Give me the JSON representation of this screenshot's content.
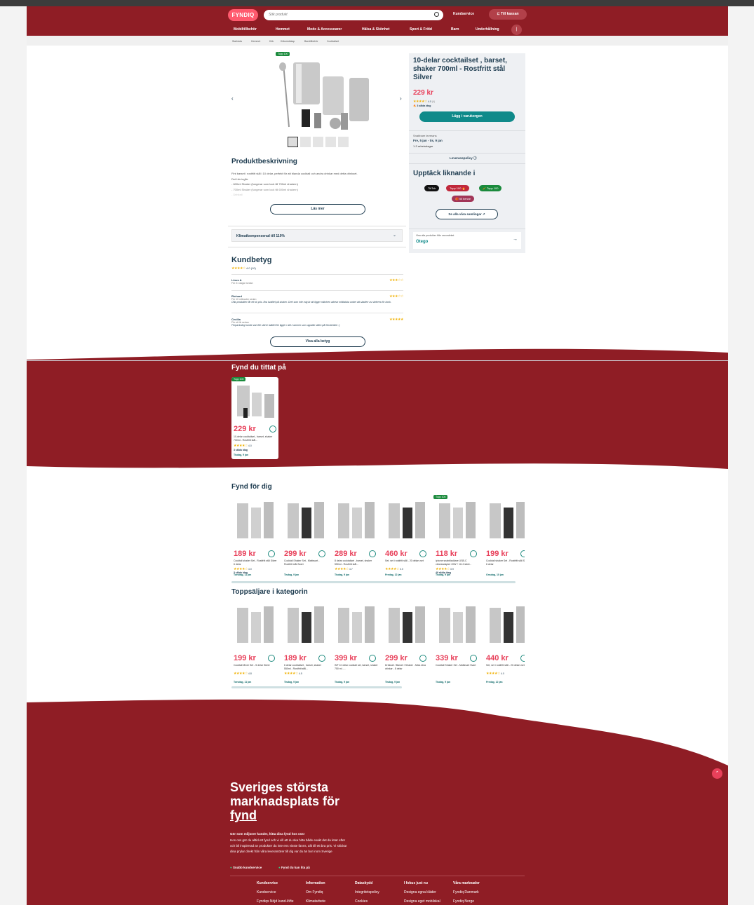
{
  "header": {
    "logo": "FYNDIQ",
    "search_placeholder": "Sök produkt",
    "customer_service": "Kundservice",
    "checkout": "Till kassan",
    "nav": [
      "Mobiltillbehör",
      "Hemmet",
      "Mode & Accessoarer",
      "Hälsa & Skönhet",
      "Sport & Fritid",
      "Barn",
      "Underhållning"
    ]
  },
  "breadcrumb": [
    "Startsida",
    "Hemmet",
    "Kök",
    "Köksredskap",
    "Barstillbehör",
    "Cocktailset"
  ],
  "product": {
    "badge": "Topp 100",
    "title": "10-delar cocktailset , barset, shaker 700ml - Rostfritt stål Silver",
    "price": "229 kr",
    "rating": "4.0",
    "rating_count": "(4)",
    "sold": "3 sålda idag",
    "add_to_cart": "Lägg i varukorgen",
    "delivery_title": "Snabbare leverans",
    "delivery_dates": "Fre, 5 jan - tis, 9 jan",
    "delivery_days": "1-3 arbetsdagar",
    "delivery_policy": "Leveranspolicy",
    "discover_title": "Upptäck liknande i",
    "chips": [
      "TikTok",
      "Topp 100 🔥",
      "🥕 Topp 100",
      "🎁 till henne"
    ],
    "collections_btn": "Se alla våra samlingar",
    "seller_label": "Visa alla produkter från varumärket",
    "seller": "Otego"
  },
  "description": {
    "title": "Produktbeskrivning",
    "text": "Fint barset i rostfritt stål i 10 delar, perfekt för att blanda cocktail och andra drinkar med detta drinkset.",
    "intro": "Det här ingår:",
    "l1": "- 600ml Shaker (fungerar som lock till 700ml shakern)",
    "l2": "- 700ml Shaker (fungerar som lock till 600ml shakern)",
    "l3": "- Drinksil",
    "read_more": "Läs mer",
    "climate": "Klimatkompenserad till 110%"
  },
  "reviews": {
    "title": "Kundbetyg",
    "avg": "4.0",
    "count": "(10)",
    "show_all": "Visa alla betyg",
    "items": [
      {
        "name": "Linus A",
        "when": "För 21 dagar sedan",
        "text": "",
        "stars": "★★★☆☆"
      },
      {
        "name": "Richard",
        "when": "För 10 månader sedan",
        "text": "Ofta produkter får ett ok pris. Bra kvalitet på shaker. Dret som inte mig är att ligger mikrinen adrear mittlotuka under att skaderr av sleteres för konk.",
        "stars": "★★★☆☆"
      },
      {
        "name": "Cecilia",
        "when": "För ett år sedan",
        "text": "Förpackning kunde vart lite större istället för ligger i allt i varmen som uppstår sliten på fönsteriken :)",
        "stars": "★★★★★"
      }
    ]
  },
  "viewed": {
    "title": "Fynd du tittat på",
    "badge": "Topp 100",
    "price": "229 kr",
    "name": "10-delar cocktailset , barset, shaker 700ml - Rostfritt stål...",
    "rating": "4.0",
    "sold": "3 sålda idag",
    "delivery": "Tisdag, 9 jan"
  },
  "for_you": {
    "title": "Fynd för dig",
    "items": [
      {
        "price": "189 kr",
        "name": "Cocktail shaker Set - Rostfritt stål Silver 6 delar",
        "rating": "4.0",
        "sold": "3 sålda idag",
        "delivery": "Torsdag, 11 jan",
        "badge": ""
      },
      {
        "price": "299 kr",
        "name": "Cocktail Shaker Set - Mattsvart - Rostfritt stål Svart",
        "rating": "",
        "sold": "",
        "delivery": "Tisdag, 9 jan",
        "badge": ""
      },
      {
        "price": "289 kr",
        "name": "8 delar cocktailset , barset, shaker 550ml - Rostfritt stål...",
        "rating": "4.7",
        "sold": "",
        "delivery": "Tisdag, 9 jan",
        "badge": ""
      },
      {
        "price": "460 kr",
        "name": "Set, set i rostfritt stål - 20 delars set",
        "rating": "3.0",
        "sold": "",
        "delivery": "Fredag, 12 jan",
        "badge": ""
      },
      {
        "price": "118 kr",
        "name": "iphone snabbladdare USB-C vänneadapter 20W + 2m Kabel...",
        "rating": "3.9",
        "sold": "49 sålda idag",
        "delivery": "Tisdag, 9 jan",
        "badge": "Topp 100"
      },
      {
        "price": "199 kr",
        "name": "Cocktail shaker Set - Rostfritt stål Silver 6 delar",
        "rating": "",
        "sold": "",
        "delivery": "Onsdag, 10 jan",
        "badge": ""
      }
    ]
  },
  "top_sellers": {
    "title": "Toppsäljare i kategorin",
    "items": [
      {
        "price": "199 kr",
        "name": "Cocktail Mixer Set - 5 delar Silver",
        "rating": "4.8",
        "delivery": "Torsdag, 11 jan"
      },
      {
        "price": "189 kr",
        "name": "6 delar cocktailset , barset, shaker 550ml - Rostfritt stål...",
        "rating": "4.5",
        "delivery": "Tisdag, 9 jan"
      },
      {
        "price": "399 kr",
        "name": "INF 10 delar cocktail set, barset, shaker 750 ml -...",
        "rating": "",
        "delivery": "Tisdag, 9 jan"
      },
      {
        "price": "299 kr",
        "name": "Drinkset / Barset / Shaker - Mixa dina drinkar - 8 delar",
        "rating": "",
        "delivery": "Tisdag, 9 jan"
      },
      {
        "price": "339 kr",
        "name": "Cocktail Shaker Set - Mattsvart Svart",
        "rating": "",
        "delivery": "Tisdag, 9 jan"
      },
      {
        "price": "440 kr",
        "name": "Set, set i rostfritt stål - 20 delars set",
        "rating": "4.0",
        "delivery": "Fredag, 12 jan"
      }
    ]
  },
  "footer": {
    "headline_1": "Sveriges största",
    "headline_2": "marknadsplats för",
    "headline_3": "fynd",
    "lead": "Gör som miljoner kunder, hitta dina fynd hos oss!",
    "body": "Hos oss gör du alltid ett fynd och vi vill att du ska hitta både exakt det du letar efter och bli inspirerad av produkter du inte ens visste fanns, allt till ett bra pris. Vi skickar dina prylar direkt från våra leverantörer till dig var du än bor inom Sverige",
    "usp1": "Snabb kundservice",
    "usp2": "Fynd du kan lita på",
    "cols": [
      {
        "h": "Kundservice",
        "a": "Kundservice",
        "b": "Fyndiqs Nöjd kund-löfte"
      },
      {
        "h": "Information",
        "a": "Om Fyndiq",
        "b": "Klimatarbete"
      },
      {
        "h": "Dataskydd",
        "a": "Integritetspolicy",
        "b": "Cookies"
      },
      {
        "h": "I fokus just nu",
        "a": "Designa egna kläder",
        "b": "Designa eget mobilskal"
      },
      {
        "h": "Våra marknader",
        "a": "Fyndiq Danmark",
        "b": "Fyndiq Norge"
      }
    ]
  },
  "colors": {
    "brand_red": "#8f1d25",
    "accent_pink": "#e8405a",
    "teal": "#0f8a8a"
  }
}
